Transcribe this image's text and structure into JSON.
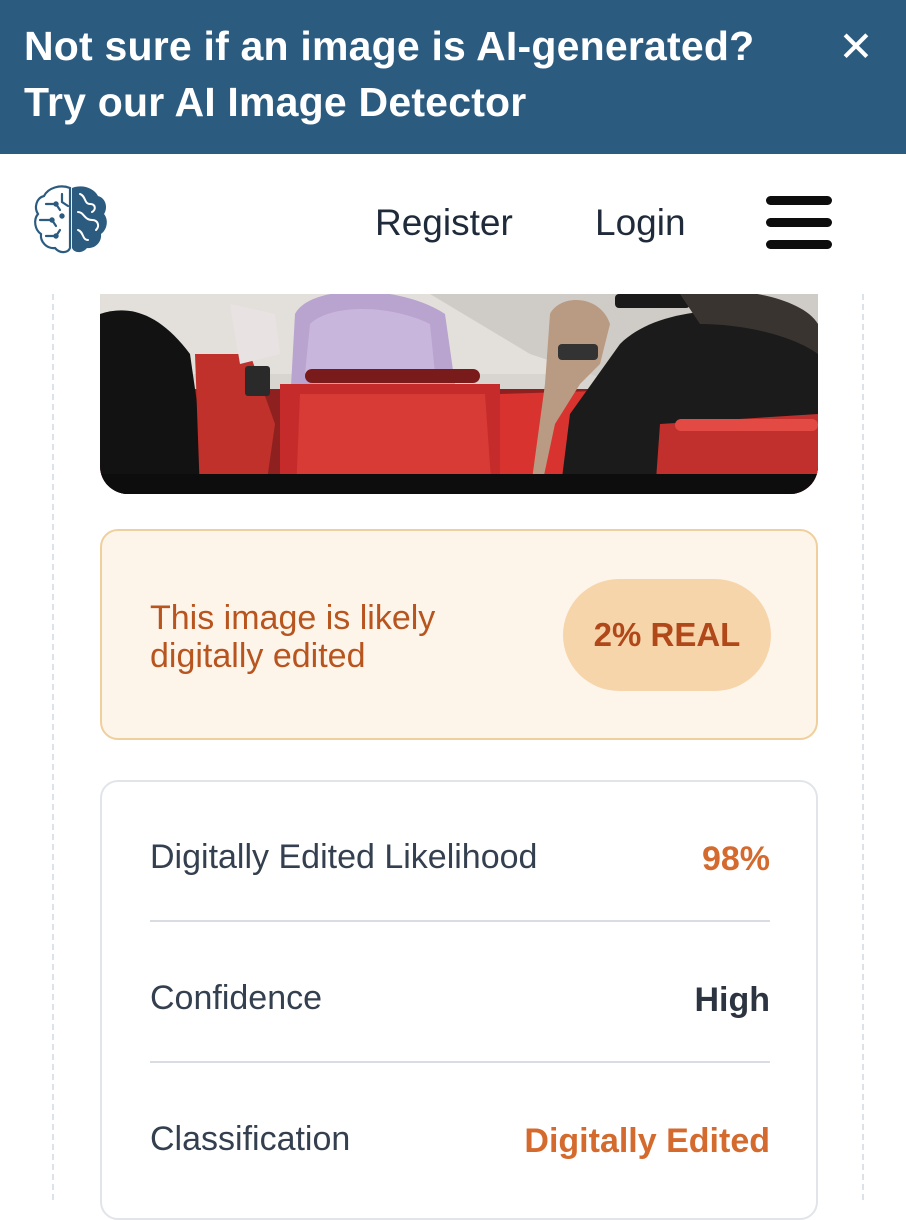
{
  "banner": {
    "line1": "Not sure if an image is AI-generated?",
    "line2": "Try our AI Image Detector",
    "close_label": "✕",
    "background": "#2c5b80"
  },
  "nav": {
    "logo_icon": "brain-icon",
    "register_label": "Register",
    "login_label": "Login",
    "menu_icon": "hamburger-menu-icon"
  },
  "result": {
    "message": "This image is likely digitally edited",
    "badge": "2% REAL"
  },
  "details": {
    "rows": [
      {
        "label": "Digitally Edited Likelihood",
        "value": "98%"
      },
      {
        "label": "Confidence",
        "value": "High"
      },
      {
        "label": "Classification",
        "value": "Digitally Edited"
      }
    ]
  },
  "colors": {
    "accent_orange": "#d46a2d",
    "result_bg": "#fdf4ea",
    "badge_bg": "#f7d5ab"
  }
}
